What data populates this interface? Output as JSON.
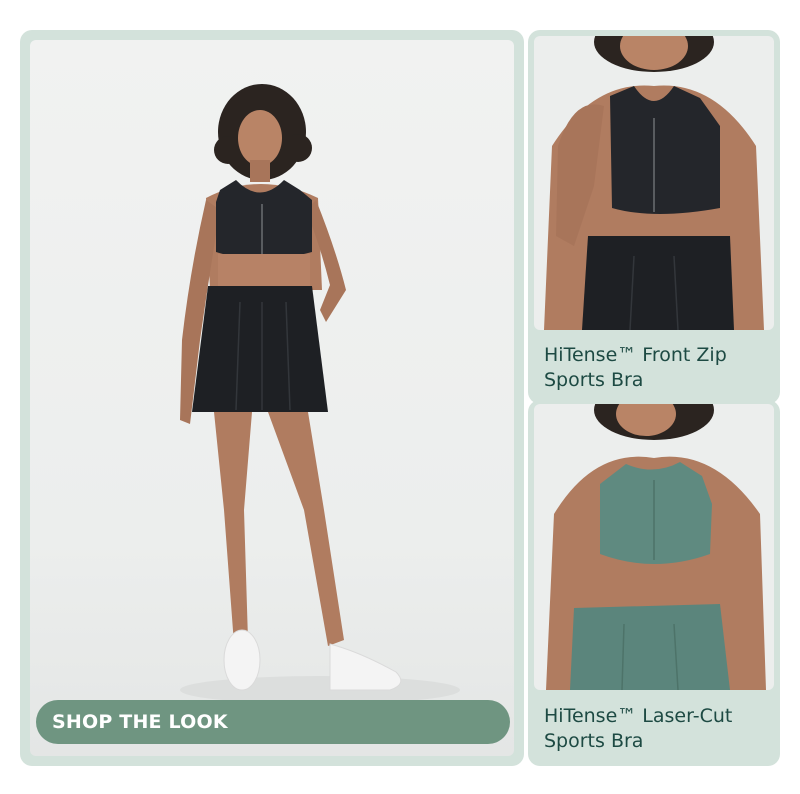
{
  "main": {
    "cta_label": "SHOP THE LOOK",
    "image_icon": "model-full-outfit-photo"
  },
  "products": [
    {
      "name_line1": "HiTense™ Front Zip",
      "name_line2": "Sports Bra",
      "image_icon": "black-front-zip-bra-photo"
    },
    {
      "name_line1": "HiTense™ Laser-Cut",
      "name_line2": "Sports Bra",
      "image_icon": "green-laser-cut-bra-photo"
    }
  ],
  "colors": {
    "panel_bg": "#d3e2db",
    "caption_text": "#1d4a43",
    "cta_bg": "#6f9581",
    "cta_text": "#ffffff"
  }
}
